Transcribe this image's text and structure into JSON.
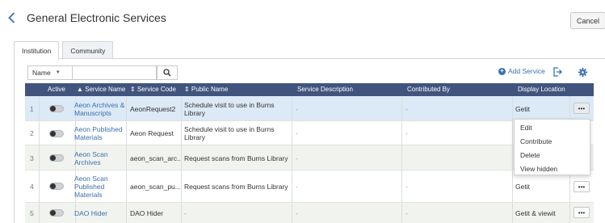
{
  "header": {
    "title": "General Electronic Services",
    "cancel_label": "Cancel"
  },
  "tabs": [
    {
      "label": "Institution",
      "active": true
    },
    {
      "label": "Community",
      "active": false
    }
  ],
  "search": {
    "field_selected": "Name",
    "value": ""
  },
  "toolbar": {
    "add_service_label": "Add Service"
  },
  "table": {
    "headers": {
      "active": "Active",
      "service_name": "▲ Service Name",
      "service_code": "⇕ Service Code",
      "public_name": "⇕ Public Name",
      "service_description": "Service Description",
      "contributed_by": "Contributed By",
      "display_location": "Display Location"
    },
    "rows": [
      {
        "num": "1",
        "name": "Aeon Archives & Manuscripts",
        "code": "AeonRequest2",
        "public_name": "Schedule visit to use in Burns Library",
        "description": "-",
        "contributed_by": "-",
        "display_location": "Getit",
        "more": "•••"
      },
      {
        "num": "2",
        "name": "Aeon Published Materials",
        "code": "Aeon Request",
        "public_name": "Schedule visit to use in Burns Library",
        "description": "-",
        "contributed_by": "-",
        "display_location": "",
        "more": ""
      },
      {
        "num": "3",
        "name": "Aeon Scan Archives",
        "code": "aeon_scan_arc...",
        "public_name": "Request scans from Burns Library",
        "description": "-",
        "contributed_by": "",
        "display_location": "",
        "more": ""
      },
      {
        "num": "4",
        "name": "Aeon Scan Published Materials",
        "code": "aeon_scan_pu...",
        "public_name": "Request scans from Burns Library",
        "description": "-",
        "contributed_by": "-",
        "display_location": "Getit",
        "more": "•••"
      },
      {
        "num": "5",
        "name": "DAO Hider",
        "code": "DAO Hider",
        "public_name": "-",
        "description": "-",
        "contributed_by": "-",
        "display_location": "Getit & viewit",
        "more": "•••"
      }
    ]
  },
  "row_menu": {
    "items": [
      "Edit",
      "Contribute",
      "Delete",
      "View hidden"
    ]
  },
  "colors": {
    "header_bg": "#40547e",
    "link": "#3a6fb0",
    "selected_row": "#dce9f6",
    "alt_row": "#f1f4ee"
  }
}
